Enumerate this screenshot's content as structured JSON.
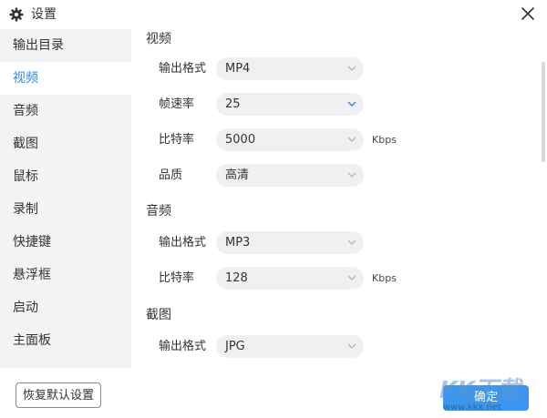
{
  "window": {
    "title": "设置",
    "icons": {
      "title": "gear-icon",
      "close": "close-icon"
    }
  },
  "sidebar": {
    "items": [
      {
        "label": "输出目录",
        "active": false
      },
      {
        "label": "视频",
        "active": true
      },
      {
        "label": "音频",
        "active": false
      },
      {
        "label": "截图",
        "active": false
      },
      {
        "label": "鼠标",
        "active": false
      },
      {
        "label": "录制",
        "active": false
      },
      {
        "label": "快捷键",
        "active": false
      },
      {
        "label": "悬浮框",
        "active": false
      },
      {
        "label": "启动",
        "active": false
      },
      {
        "label": "主面板",
        "active": false
      }
    ]
  },
  "content": {
    "video": {
      "title": "视频",
      "format_label": "输出格式",
      "format_value": "MP4",
      "fps_label": "帧速率",
      "fps_value": "25",
      "bitrate_label": "比特率",
      "bitrate_value": "5000",
      "bitrate_unit": "Kbps",
      "quality_label": "品质",
      "quality_value": "高清"
    },
    "audio": {
      "title": "音频",
      "format_label": "输出格式",
      "format_value": "MP3",
      "bitrate_label": "比特率",
      "bitrate_value": "128",
      "bitrate_unit": "Kbps"
    },
    "screenshot": {
      "title": "截图",
      "format_label": "输出格式",
      "format_value": "JPG"
    }
  },
  "footer": {
    "reset_label": "恢复默认设置",
    "ok_label": "确定"
  },
  "watermark": {
    "logo": "KK下载",
    "url": "www.kkx.net"
  },
  "colors": {
    "accent": "#2f8ae6",
    "ok_button": "#3c96ef",
    "sidebar_bg": "#f3f3f5",
    "select_bg": "#f0f0f2",
    "chevron_active": "#2f8ae6",
    "chevron_inactive": "#b5b5b5"
  }
}
